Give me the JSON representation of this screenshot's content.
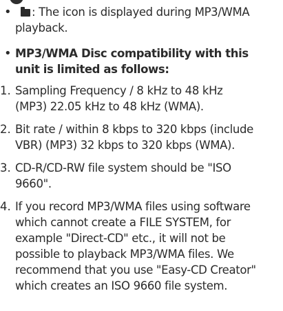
{
  "bullets": [
    {
      "icon": "folder-icon",
      "text": ": The icon is displayed during MP3/WMA\nplayback."
    },
    {
      "text": "MP3/WMA Disc compatibility with this\nunit is limited as follows:"
    }
  ],
  "list": [
    {
      "number": "1.",
      "text": "Sampling Frequency / 8 kHz to 48 kHz\n(MP3) 22.05 kHz to 48 kHz (WMA)."
    },
    {
      "number": "2.",
      "text": "Bit rate / within 8 kbps to 320 kbps (include\nVBR) (MP3) 32 kbps to 320 kbps (WMA)."
    },
    {
      "number": "3.",
      "text": "CD-R/CD-RW file system should be \"ISO\n9660\"."
    },
    {
      "number": "4.",
      "text": "If you record MP3/WMA files using software\nwhich cannot create a FILE SYSTEM, for\nexample \"Direct-CD\" etc., it will not be\npossible to playback MP3/WMA files. We\nrecommend that you use \"Easy-CD Creator\"\nwhich creates an ISO 9660 file system."
    }
  ]
}
